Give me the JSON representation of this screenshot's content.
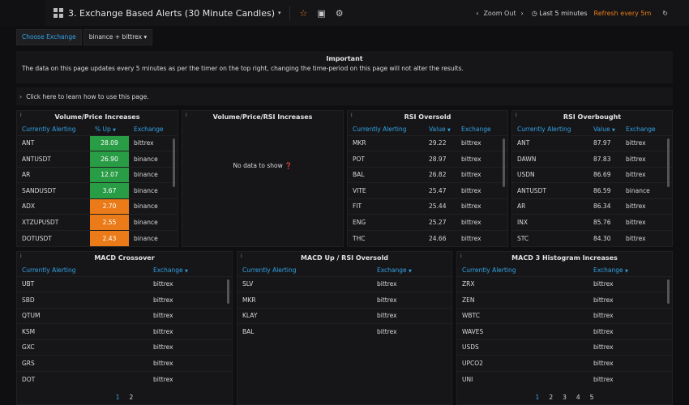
{
  "header": {
    "title": "3. Exchange Based Alerts (30 Minute Candles)",
    "zoom_out": "Zoom Out",
    "time_range": "Last 5 minutes",
    "refresh": "Refresh every 5m"
  },
  "variables": {
    "label": "Choose Exchange",
    "value": "binance + bittrex"
  },
  "important": {
    "title": "Important",
    "text": "The data on this page updates every 5 minutes as per the timer on the top right, changing the time-period on this page will not alter the results."
  },
  "help_row": {
    "label": "Click here to learn how to use this page."
  },
  "panels": {
    "volume_price": {
      "title": "Volume/Price Increases",
      "headers": [
        "Currently Alerting",
        "% Up",
        "Exchange"
      ],
      "rows": [
        {
          "name": "ANT",
          "value": "28.09",
          "exchange": "bittrex",
          "color": "green"
        },
        {
          "name": "ANTUSDT",
          "value": "26.90",
          "exchange": "binance",
          "color": "green"
        },
        {
          "name": "AR",
          "value": "12.07",
          "exchange": "binance",
          "color": "green"
        },
        {
          "name": "SANDUSDT",
          "value": "3.67",
          "exchange": "binance",
          "color": "green"
        },
        {
          "name": "ADX",
          "value": "2.70",
          "exchange": "binance",
          "color": "orange"
        },
        {
          "name": "XTZUPUSDT",
          "value": "2.55",
          "exchange": "binance",
          "color": "orange"
        },
        {
          "name": "DOTUSDT",
          "value": "2.43",
          "exchange": "binance",
          "color": "orange"
        }
      ]
    },
    "volume_price_rsi": {
      "title": "Volume/Price/RSI Increases",
      "no_data": "No data to show"
    },
    "rsi_oversold": {
      "title": "RSI Oversold",
      "headers": [
        "Currently Alerting",
        "Value",
        "Exchange"
      ],
      "rows": [
        {
          "name": "MKR",
          "value": "29.22",
          "exchange": "bittrex"
        },
        {
          "name": "POT",
          "value": "28.97",
          "exchange": "bittrex"
        },
        {
          "name": "BAL",
          "value": "26.82",
          "exchange": "bittrex"
        },
        {
          "name": "VITE",
          "value": "25.47",
          "exchange": "bittrex"
        },
        {
          "name": "FIT",
          "value": "25.44",
          "exchange": "bittrex"
        },
        {
          "name": "ENG",
          "value": "25.27",
          "exchange": "bittrex"
        },
        {
          "name": "THC",
          "value": "24.66",
          "exchange": "bittrex"
        }
      ]
    },
    "rsi_overbought": {
      "title": "RSI Overbought",
      "headers": [
        "Currently Alerting",
        "Value",
        "Exchange"
      ],
      "rows": [
        {
          "name": "ANT",
          "value": "87.97",
          "exchange": "bittrex"
        },
        {
          "name": "DAWN",
          "value": "87.83",
          "exchange": "bittrex"
        },
        {
          "name": "USDN",
          "value": "86.69",
          "exchange": "bittrex"
        },
        {
          "name": "ANTUSDT",
          "value": "86.59",
          "exchange": "binance"
        },
        {
          "name": "AR",
          "value": "86.34",
          "exchange": "bittrex"
        },
        {
          "name": "INX",
          "value": "85.76",
          "exchange": "bittrex"
        },
        {
          "name": "STC",
          "value": "84.30",
          "exchange": "bittrex"
        }
      ]
    },
    "macd_crossover": {
      "title": "MACD Crossover",
      "headers": [
        "Currently Alerting",
        "Exchange"
      ],
      "rows": [
        {
          "name": "UBT",
          "exchange": "bittrex"
        },
        {
          "name": "SBD",
          "exchange": "bittrex"
        },
        {
          "name": "QTUM",
          "exchange": "bittrex"
        },
        {
          "name": "KSM",
          "exchange": "bittrex"
        },
        {
          "name": "GXC",
          "exchange": "bittrex"
        },
        {
          "name": "GRS",
          "exchange": "bittrex"
        },
        {
          "name": "DOT",
          "exchange": "bittrex"
        }
      ],
      "pages": [
        "1",
        "2"
      ]
    },
    "macd_rsi": {
      "title": "MACD Up / RSI Oversold",
      "headers": [
        "Currently Alerting",
        "Exchange"
      ],
      "rows": [
        {
          "name": "SLV",
          "exchange": "bittrex"
        },
        {
          "name": "MKR",
          "exchange": "bittrex"
        },
        {
          "name": "KLAY",
          "exchange": "bittrex"
        },
        {
          "name": "BAL",
          "exchange": "bittrex"
        }
      ]
    },
    "macd_histogram": {
      "title": "MACD 3 Histogram Increases",
      "headers": [
        "Currently Alerting",
        "Exchange"
      ],
      "rows": [
        {
          "name": "ZRX",
          "exchange": "bittrex"
        },
        {
          "name": "ZEN",
          "exchange": "bittrex"
        },
        {
          "name": "WBTC",
          "exchange": "bittrex"
        },
        {
          "name": "WAVES",
          "exchange": "bittrex"
        },
        {
          "name": "USDS",
          "exchange": "bittrex"
        },
        {
          "name": "UPCO2",
          "exchange": "bittrex"
        },
        {
          "name": "UNI",
          "exchange": "bittrex"
        }
      ],
      "pages": [
        "1",
        "2",
        "3",
        "4",
        "5"
      ]
    }
  },
  "colors": {
    "accent": "#33a2e5",
    "green": "#299c46",
    "orange": "#eb7b18"
  }
}
